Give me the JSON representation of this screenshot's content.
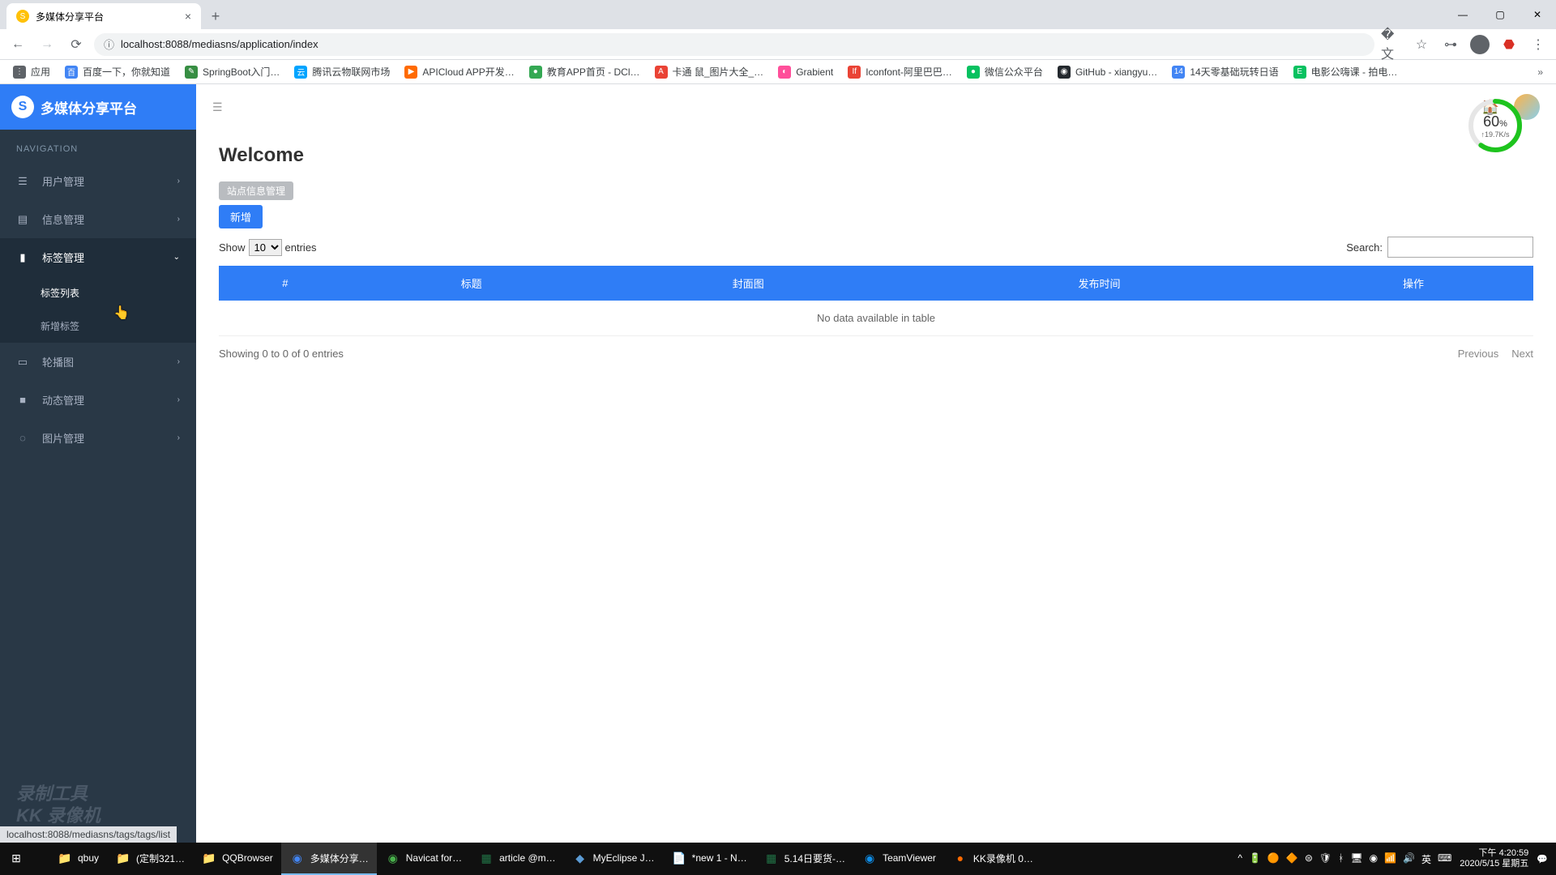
{
  "browser": {
    "tab_title": "多媒体分享平台",
    "url": "localhost:8088/mediasns/application/index",
    "bookmarks": [
      {
        "label": "应用",
        "color": "#5f6368",
        "glyph": "⋮⋮⋮"
      },
      {
        "label": "百度一下，你就知道",
        "color": "#4285f4",
        "glyph": "百"
      },
      {
        "label": "SpringBoot入门…",
        "color": "#378e43",
        "glyph": "✎"
      },
      {
        "label": "腾讯云物联网市场",
        "color": "#00a4ff",
        "glyph": "云"
      },
      {
        "label": "APICloud APP开发…",
        "color": "#ff6a00",
        "glyph": "▶"
      },
      {
        "label": "教育APP首页 - DCl…",
        "color": "#34a853",
        "glyph": "●"
      },
      {
        "label": "卡通 鼠_图片大全_…",
        "color": "#ea4335",
        "glyph": "A"
      },
      {
        "label": "Grabient",
        "color": "#ff4f9a",
        "glyph": "◐"
      },
      {
        "label": "Iconfont-阿里巴巴…",
        "color": "#ea4335",
        "glyph": "If"
      },
      {
        "label": "微信公众平台",
        "color": "#07c160",
        "glyph": "●"
      },
      {
        "label": "GitHub - xiangyu…",
        "color": "#24292e",
        "glyph": "◉"
      },
      {
        "label": "14天零基础玩转日语",
        "color": "#4285f4",
        "glyph": "14"
      },
      {
        "label": "电影公嗨课 - 拍电…",
        "color": "#07c160",
        "glyph": "E"
      }
    ]
  },
  "sidebar": {
    "brand": "多媒体分享平台",
    "nav_header": "NAVIGATION",
    "items": [
      {
        "icon": "☰",
        "label": "用户管理",
        "expanded": false
      },
      {
        "icon": "▤",
        "label": "信息管理",
        "expanded": false
      },
      {
        "icon": "▮",
        "label": "标签管理",
        "expanded": true,
        "children": [
          {
            "label": "标签列表",
            "active": true
          },
          {
            "label": "新增标签",
            "active": false
          }
        ]
      },
      {
        "icon": "▭",
        "label": "轮播图",
        "expanded": false
      },
      {
        "icon": "■",
        "label": "动态管理",
        "expanded": false
      },
      {
        "icon": "◌",
        "label": "图片管理",
        "expanded": false
      }
    ],
    "watermark_line1": "录制工具",
    "watermark_line2": "KK 录像机"
  },
  "page": {
    "title": "Welcome",
    "badge": "站点信息管理",
    "add_button": "新增",
    "progress_pct": "60",
    "progress_unit": "%",
    "progress_sub": "↑19.7K/s",
    "show_label": "Show",
    "entries_label": "entries",
    "show_value": "10",
    "search_label": "Search:",
    "columns": [
      "#",
      "标题",
      "封面图",
      "发布时间",
      "操作"
    ],
    "empty_text": "No data available in table",
    "info_text": "Showing 0 to 0 of 0 entries",
    "prev": "Previous",
    "next": "Next"
  },
  "status_url": "localhost:8088/mediasns/tags/tags/list",
  "taskbar": {
    "items": [
      {
        "icon": "⊞",
        "label": "",
        "color": "#fff"
      },
      {
        "icon": "📁",
        "label": "qbuy",
        "color": "#ffb900"
      },
      {
        "icon": "📁",
        "label": "(定制321…",
        "color": "#ffb900"
      },
      {
        "icon": "📁",
        "label": "QQBrowser",
        "color": "#ffb900"
      },
      {
        "icon": "◉",
        "label": "多媒体分享…",
        "color": "#4285f4",
        "active": true
      },
      {
        "icon": "◉",
        "label": "Navicat for…",
        "color": "#48b04b"
      },
      {
        "icon": "▦",
        "label": "article @m…",
        "color": "#217346"
      },
      {
        "icon": "◆",
        "label": "MyEclipse J…",
        "color": "#5b9bd5"
      },
      {
        "icon": "📄",
        "label": "*new 1 - N…",
        "color": "#8fbc8f"
      },
      {
        "icon": "▦",
        "label": "5.14日要货-…",
        "color": "#217346"
      },
      {
        "icon": "◉",
        "label": "TeamViewer",
        "color": "#0e8ee9"
      },
      {
        "icon": "●",
        "label": "KK录像机 0…",
        "color": "#ff6a00"
      }
    ],
    "time": "下午 4:20:59",
    "date": "2020/5/15 星期五"
  }
}
